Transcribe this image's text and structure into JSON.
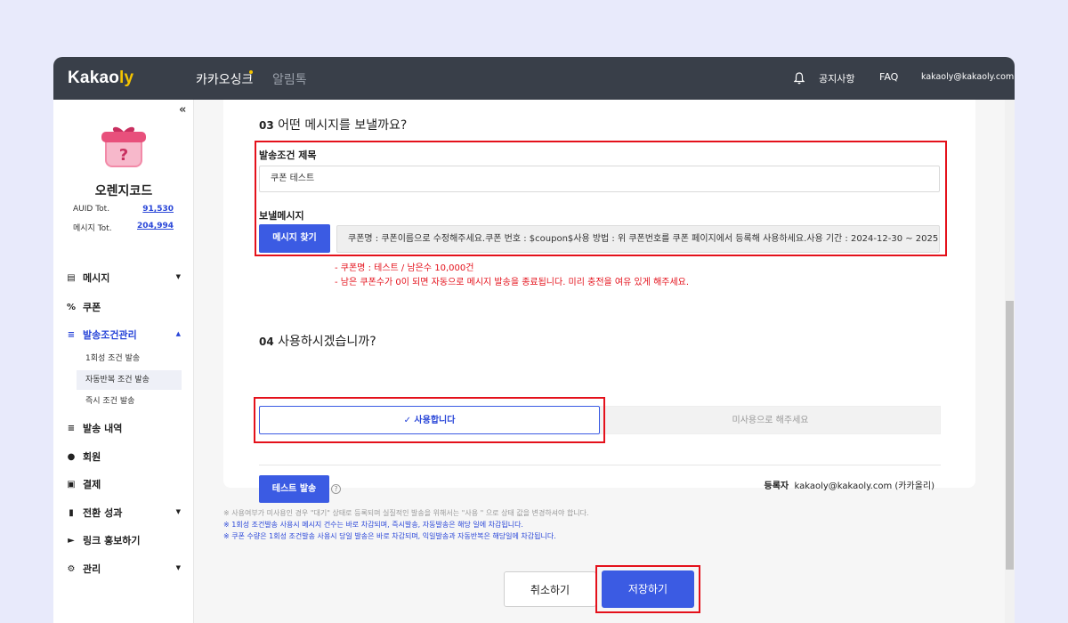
{
  "topbar": {
    "logo_main": "Kakao",
    "logo_accent": "ly",
    "tabs": [
      "카카오싱크",
      "알림톡"
    ],
    "notice": "공지사항",
    "faq": "FAQ",
    "user_email": "kakaoly@kakaoly.com"
  },
  "sidebar": {
    "collapse": "«",
    "org_name": "오렌지코드",
    "stats": [
      {
        "label": "AUID Tot.",
        "value": "91,530"
      },
      {
        "label": "메시지 Tot.",
        "value": "204,994"
      }
    ],
    "menu": {
      "message": "메시지",
      "coupon": "쿠폰",
      "condition": "발송조건관리",
      "sub_once": "1회성 조건 발송",
      "sub_repeat": "자동반복 조건 발송",
      "sub_instant": "즉시 조건 발송",
      "history": "발송 내역",
      "member": "회원",
      "payment": "결제",
      "conversion": "전환 성과",
      "link": "링크 홍보하기",
      "manage": "관리"
    }
  },
  "section03": {
    "num": "03",
    "title": "어떤 메시지를 보낼까요?",
    "title_label": "발송조건 제목",
    "title_value": "쿠폰 테스트",
    "message_label": "보낼메시지",
    "find_button": "메시지 찾기",
    "message_value": "쿠폰명 : 쿠폰이름으로 수정해주세요.쿠폰 번호 : $coupon$사용 방법 : 위 쿠폰번호를 쿠폰 페이지에서 등록해 사용하세요.사용 기간 : 2024-12-30 ~ 2025",
    "note1": "- 쿠폰명 : 테스트 / 남은수 10,000건",
    "note2": "- 남은 쿠폰수가 0이 되면 자동으로 메시지 발송을 종료됩니다. 미리 충전을 여유 있게 해주세요."
  },
  "section04": {
    "num": "04",
    "title": "사용하시겠습니까?",
    "use_option": "✓ 사용합니다",
    "unuse_option": "미사용으로 해주세요"
  },
  "test_button": "테스트 발송",
  "help_icon": "?",
  "registrant": {
    "label": "등록자",
    "value": "kakaoly@kakaoly.com (카카올리)"
  },
  "footnotes": [
    "※ 사용여부가 미사용인 경우 \"대기\" 상태로 등록되며 실질적인 발송을 위해서는 \"사용 \" 으로 상태 값을 변경하셔야 합니다.",
    "※ 1회성 조건발송 사용시 메시지 건수는 바로 차감되며, 즉시발송, 자동발송은 해당 일에 차감됩니다.",
    "※ 쿠폰 수량은 1회성 조건발송 사용시 당일 발송은 바로 차감되며, 익일발송과 자동반복은 해당일에 차감됩니다."
  ],
  "buttons": {
    "cancel": "취소하기",
    "save": "저장하기"
  },
  "colors": {
    "accent": "#3b5be3",
    "highlight": "#e4111b",
    "logo_accent": "#f5c400",
    "topbar": "#393f49"
  }
}
